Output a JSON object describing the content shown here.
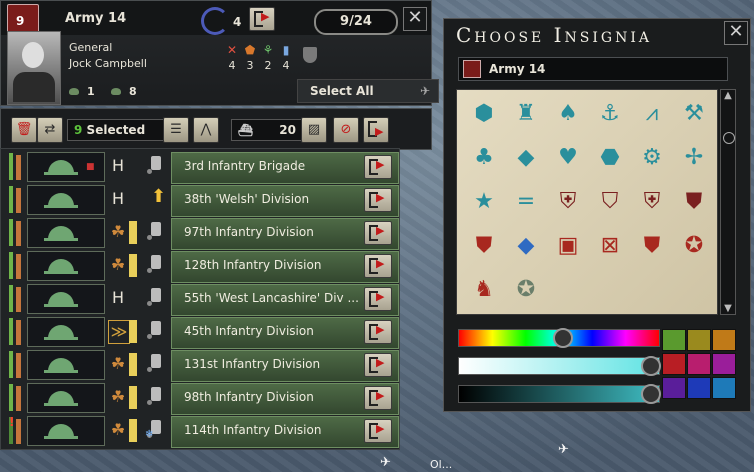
{
  "header": {
    "badge_text": "9",
    "army_name": "Army 14",
    "laurel_count": "4",
    "unit_counter": "9/24",
    "rank": "General",
    "general_name": "Jock Campbell",
    "traits": [
      {
        "icon": "crossed-swords-icon",
        "glyph": "✕",
        "value": "4",
        "color": "#e05040"
      },
      {
        "icon": "shield-icon",
        "glyph": "⬟",
        "value": "3",
        "color": "#d8782c"
      },
      {
        "icon": "planning-icon",
        "glyph": "⚘",
        "value": "2",
        "color": "#6cc06a"
      },
      {
        "icon": "logistics-icon",
        "glyph": "▮",
        "value": "4",
        "color": "#7aa8e0"
      }
    ],
    "stat_a": "1",
    "stat_b": "8",
    "select_all": "Select All"
  },
  "toolbar": {
    "selected_count": "9",
    "selected_label": "Selected",
    "ship_count": "20"
  },
  "divisions": [
    {
      "name": "3rd Infantry Brigade",
      "mark": "H",
      "yellow": false,
      "alert": false,
      "flag": true
    },
    {
      "name": "38th 'Welsh' Division",
      "mark": "H",
      "yellow": false,
      "arrow": true,
      "alert": false
    },
    {
      "name": "97th Infantry Division",
      "mark": "☘",
      "yellow": true,
      "alert": false
    },
    {
      "name": "128th Infantry Division",
      "mark": "☘",
      "yellow": true,
      "alert": false
    },
    {
      "name": "55th 'West Lancashire' Div ...",
      "mark": "H",
      "yellow": false,
      "alert": false
    },
    {
      "name": "45th Infantry Division",
      "mark": "≫",
      "yellow": true,
      "alert": false
    },
    {
      "name": "131st Infantry Division",
      "mark": "☘",
      "yellow": true,
      "alert": false
    },
    {
      "name": "98th Infantry Division",
      "mark": "☘",
      "yellow": true,
      "alert": false
    },
    {
      "name": "114th Infantry Division",
      "mark": "☘",
      "yellow": true,
      "alert": true,
      "alert_text": "!"
    }
  ],
  "insignia_panel": {
    "title": "Choose Insignia",
    "army_name": "Army 14",
    "symbols": [
      {
        "name": "shield-insignia-icon",
        "glyph": "⬢"
      },
      {
        "name": "castle-insignia-icon",
        "glyph": "♜"
      },
      {
        "name": "spade-insignia-icon",
        "glyph": "♠"
      },
      {
        "name": "anchor-insignia-icon",
        "glyph": "⚓"
      },
      {
        "name": "chevron-insignia-icon",
        "glyph": "⩘"
      },
      {
        "name": "wrench-insignia-icon",
        "glyph": "⚒"
      },
      {
        "name": "club-insignia-icon",
        "glyph": "♣"
      },
      {
        "name": "diamond-insignia-icon",
        "glyph": "◆"
      },
      {
        "name": "heart-insignia-icon",
        "glyph": "♥"
      },
      {
        "name": "hexagon-insignia-icon",
        "glyph": "⬣"
      },
      {
        "name": "cog-insignia-icon",
        "glyph": "⚙"
      },
      {
        "name": "spark-insignia-icon",
        "glyph": "✢"
      },
      {
        "name": "star-insignia-icon",
        "glyph": "★"
      },
      {
        "name": "bars-insignia-icon",
        "glyph": "="
      },
      {
        "name": "cross-shield-insignia-icon",
        "glyph": "⛨"
      },
      {
        "name": "blue-shield-insignia-icon",
        "glyph": "⛉"
      },
      {
        "name": "yellow-cross-shield-insignia-icon",
        "glyph": "⛨"
      },
      {
        "name": "tiger-shield-insignia-icon",
        "glyph": "⛊"
      },
      {
        "name": "red-crest-insignia-icon",
        "glyph": "⛊"
      },
      {
        "name": "green-diamond-insignia-icon",
        "glyph": "◆"
      },
      {
        "name": "bulldog-insignia-icon",
        "glyph": "▣"
      },
      {
        "name": "crossed-insignia-icon",
        "glyph": "⊠"
      },
      {
        "name": "stars-shield-insignia-icon",
        "glyph": "⛊"
      },
      {
        "name": "medal-insignia-icon",
        "glyph": "✪"
      },
      {
        "name": "lion-insignia-icon",
        "glyph": "♞"
      },
      {
        "name": "round-star-insignia-icon",
        "glyph": "✪"
      }
    ],
    "palette": [
      "#5a9a2e",
      "#9a8a1e",
      "#c07a18",
      "#b81e24",
      "#b81e6e",
      "#9a1e9a",
      "#5a1e9a",
      "#1e3ab8",
      "#1e7ab8"
    ]
  },
  "map": {
    "city_label": "Ol..."
  }
}
